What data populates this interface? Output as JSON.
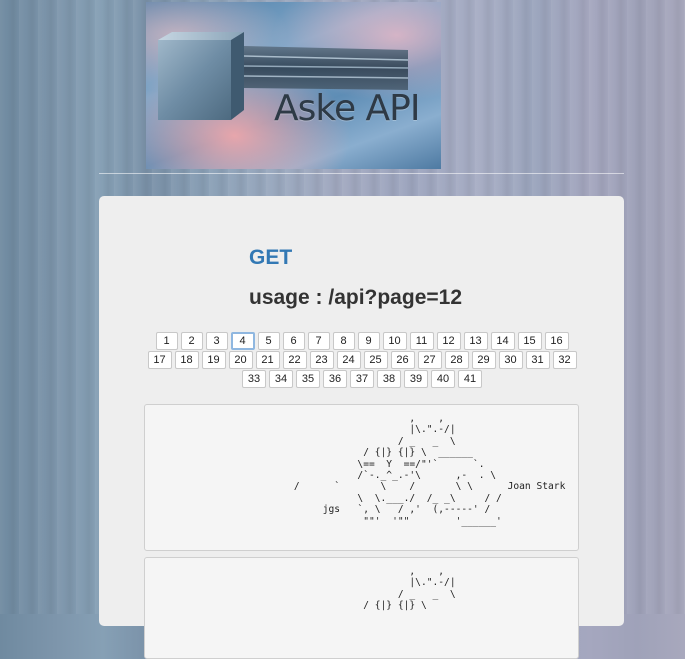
{
  "header": {
    "logo_text": "Aske API"
  },
  "api": {
    "method": "GET",
    "usage": "usage : /api?page=12"
  },
  "pagination": {
    "current": 4,
    "pages": [
      "1",
      "2",
      "3",
      "4",
      "5",
      "6",
      "7",
      "8",
      "9",
      "10",
      "11",
      "12",
      "13",
      "14",
      "15",
      "16",
      "17",
      "18",
      "19",
      "20",
      "21",
      "22",
      "23",
      "24",
      "25",
      "26",
      "27",
      "28",
      "29",
      "30",
      "31",
      "32",
      "33",
      "34",
      "35",
      "36",
      "37",
      "38",
      "39",
      "40",
      "41"
    ]
  },
  "entries": [
    {
      "ascii": "                         ,    ,\n                         |\\.\".-/|\n                       / _   _  \\\n                 / {|} {|} \\  ______\n                \\==  Y  ==/\"'`      `.\n                /`-._^_.-'\\      ,-  . \\\n     /      `       \\    /       \\ \\      Joan Stark\n                \\  \\.___./  /_ _\\     / /\n          jgs   `, \\   / ,'  (,-----' /\n                 \"\"'  '\"\"        '______'"
    },
    {
      "ascii": "                         ,    ,\n                         |\\.\".-/|\n                       / _   _  \\\n                 / {|} {|} \\"
    }
  ],
  "colors": {
    "method": "#3278b4",
    "card_bg": "#eeeeee",
    "active_page_border": "#8fb7e0"
  }
}
